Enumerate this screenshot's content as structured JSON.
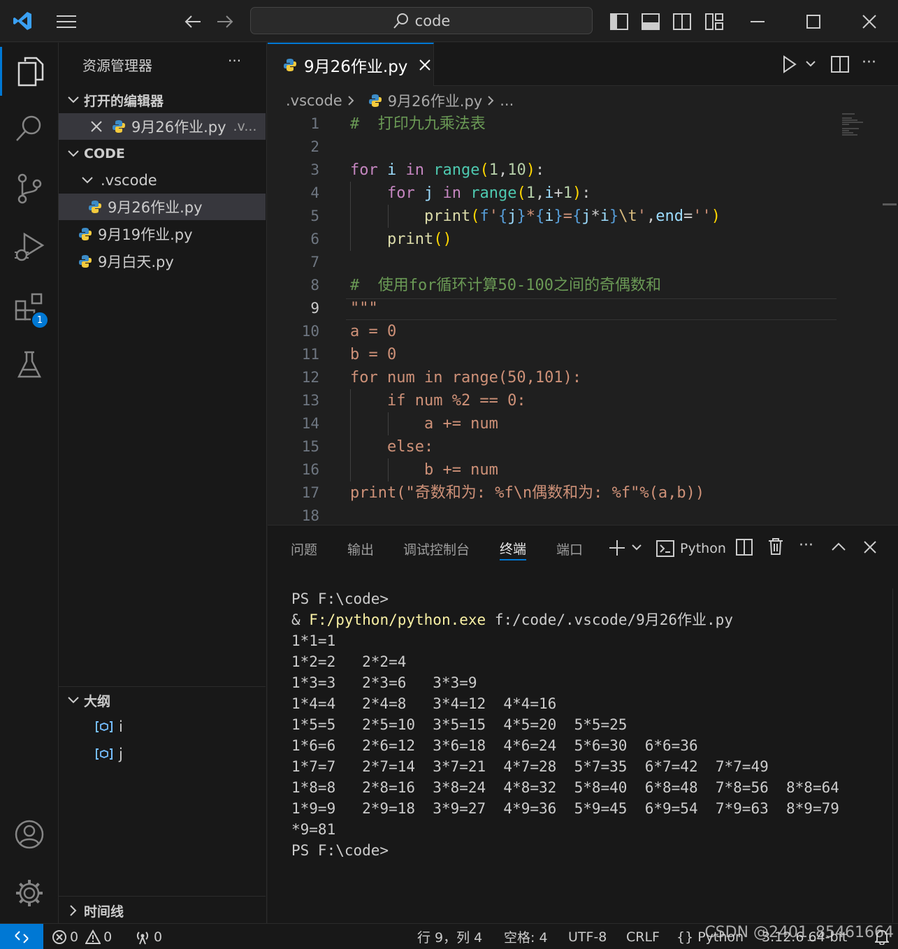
{
  "titlebar": {
    "search_text": "code"
  },
  "activity": {
    "extensions_badge": "1"
  },
  "sidebar": {
    "title": "资源管理器",
    "more": "···",
    "open_editors_header": "打开的编辑器",
    "open_editor_item": "9月26作业.py",
    "open_editor_suffix": ".v...",
    "workspace_header": "CODE",
    "folder": ".vscode",
    "files": [
      "9月26作业.py",
      "9月19作业.py",
      "9月白天.py"
    ],
    "outline_header": "大纲",
    "outline_items": [
      "i",
      "j"
    ],
    "timeline_header": "时间线"
  },
  "editor": {
    "tab_label": "9月26作业.py",
    "breadcrumb": [
      ".vscode",
      "9月26作业.py",
      "..."
    ],
    "line_numbers": [
      "1",
      "2",
      "3",
      "4",
      "5",
      "6",
      "7",
      "8",
      "9",
      "10",
      "11",
      "12",
      "13",
      "14",
      "15",
      "16",
      "17",
      "18"
    ],
    "current_line": 9
  },
  "panel": {
    "tabs": [
      "问题",
      "输出",
      "调试控制台",
      "终端",
      "端口"
    ],
    "active_tab": "终端",
    "terminal_profile": "Python",
    "terminal_lines": [
      "PS F:\\code>",
      "1*1=1",
      "1*2=2   2*2=4",
      "1*3=3   2*3=6   3*3=9",
      "1*4=4   2*4=8   3*4=12  4*4=16",
      "1*5=5   2*5=10  3*5=15  4*5=20  5*5=25",
      "1*6=6   2*6=12  3*6=18  4*6=24  5*6=30  6*6=36",
      "1*7=7   2*7=14  3*7=21  4*7=28  5*7=35  6*7=42  7*7=49",
      "1*8=8   2*8=16  3*8=24  4*8=32  5*8=40  6*8=48  7*8=56  8*8=64",
      "1*9=9   2*9=18  3*9=27  4*9=36  5*9=45  6*9=54  7*9=63  8*9=79",
      "*9=81",
      "PS F:\\code>"
    ],
    "command": {
      "amp": "& ",
      "exe": "F:/python/python.exe",
      "arg": " f:/code/.vscode/9月26作业.py"
    }
  },
  "status": {
    "errors": "0",
    "warnings": "0",
    "ports": "0",
    "position": "行 9，列 4",
    "spaces": "空格: 4",
    "encoding": "UTF-8",
    "eol": "CRLF",
    "language": "{} Python",
    "interpreter": "3.12.6 64-bit"
  },
  "watermark": "CSDN @2401_85461664"
}
